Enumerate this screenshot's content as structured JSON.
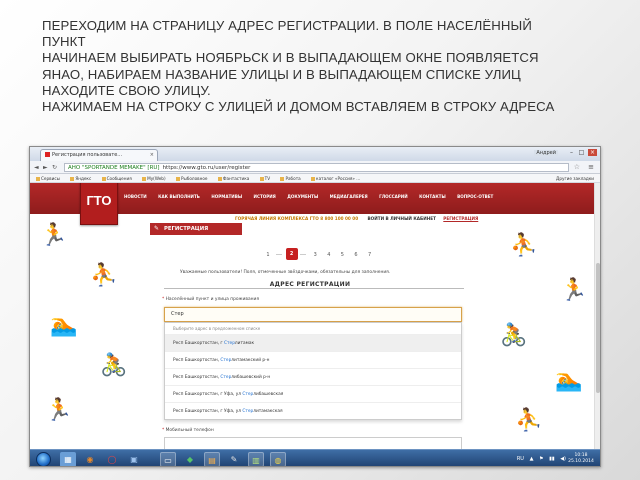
{
  "slide": {
    "lines": [
      "Переходим на страницу адрес регистрации.  В поле населённый",
      "пункт",
      "Начинаем выбирать Ноябрьск и в выпадающем окне появляется",
      "ЯНАО, набираем  название улицы    и в выпадающем списке улиц",
      "находите свою улицу.",
      "Нажимаем на строку с улицей и домом  вставляем в строку адреса"
    ]
  },
  "browser": {
    "tab_title": "Регистрация пользовате...",
    "tab_close": "×",
    "profile": "Андрей",
    "win_minimize": "–",
    "win_maximize": "□",
    "win_close": "×",
    "back": "◄",
    "forward": "►",
    "reload": "↻",
    "secure_label": "АНО \"SPORTANDE MEMAKE\" [RU]",
    "url": "https://www.gto.ru/user/register",
    "star": "☆",
    "menu": "≡",
    "bookmarks": [
      "Сервисы",
      "Яндекс",
      "Сообщения",
      "My(Web)",
      "Рыболовное",
      "Фантастика",
      "TV",
      "Работа",
      "каталог «Россия» ..."
    ],
    "bookmarks_right": "Другие закладки"
  },
  "site": {
    "logo": "ГТО",
    "nav": [
      "НОВОСТИ",
      "КАК ВЫПОЛНИТЬ",
      "НОРМАТИВЫ",
      "ИСТОРИЯ",
      "ДОКУМЕНТЫ",
      "МЕДИАГАЛЕРЕЯ",
      "ГЛОССАРИЙ",
      "КОНТАКТЫ",
      "ВОПРОС-ОТВЕТ"
    ],
    "hotline": "ГОРЯЧАЯ ЛИНИЯ КОМПЛЕКСА ГТО 8 800 100 00 00",
    "login": "ВОЙТИ В ЛИЧНЫЙ КАБИНЕТ",
    "register": "РЕГИСТРАЦИЯ",
    "ribbon": "РЕГИСТРАЦИЯ"
  },
  "form": {
    "steps": [
      "1",
      "2",
      "3",
      "4",
      "5",
      "6",
      "7"
    ],
    "active_step": "2",
    "notice": "Уважаемые пользователи! Поля, отмеченные звёздочками, обязательны для заполнения.",
    "section_title": "АДРЕС РЕГИСТРАЦИИ",
    "field_label": "Населённый пункт и улица проживания",
    "required_mark": "*",
    "input_value": "Стер",
    "dropdown_hint": "Выберите адрес в предложенном списке",
    "suggestions": [
      {
        "pre": "Респ Башкортостан, г ",
        "match": "Стер",
        "post": "литамак"
      },
      {
        "pre": "Респ Башкортостан, ",
        "match": "Стер",
        "post": "литамакский р-н"
      },
      {
        "pre": "Респ Башкортостан, ",
        "match": "Стер",
        "post": "либашевский р-н"
      },
      {
        "pre": "Респ Башкортостан, г Уфа, ул ",
        "match": "Стер",
        "post": "либашевская"
      },
      {
        "pre": "Респ Башкортостан, г Уфа, ул ",
        "match": "Стер",
        "post": "литамакская"
      }
    ],
    "phone_label": "Мобильный телефон"
  },
  "taskbar": {
    "tray_lang": "RU",
    "tray_icons": [
      "▲",
      "⚑",
      "▮▮",
      "◀)"
    ],
    "clock_time": "10:18",
    "clock_date": "25.10.2014"
  }
}
